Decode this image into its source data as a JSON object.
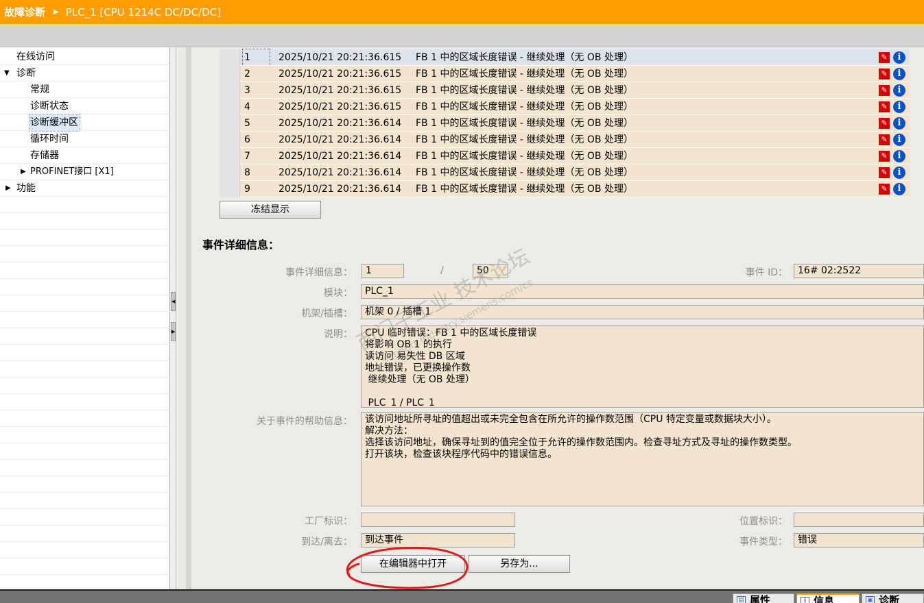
{
  "title": {
    "main": "故障诊断",
    "device": "PLC_1 [CPU 1214C DC/DC/DC]"
  },
  "sidebar": {
    "items": [
      {
        "label": "在线访问",
        "arrow": ""
      },
      {
        "label": "诊断",
        "arrow": "▼"
      },
      {
        "label": "常规",
        "arrow": ""
      },
      {
        "label": "诊断状态",
        "arrow": ""
      },
      {
        "label": "诊断缓冲区",
        "arrow": ""
      },
      {
        "label": "循环时间",
        "arrow": ""
      },
      {
        "label": "存储器",
        "arrow": ""
      },
      {
        "label": "PROFINET接口 [X1]",
        "arrow": "▶"
      },
      {
        "label": "功能",
        "arrow": "▶"
      }
    ]
  },
  "buffer": {
    "rows": [
      {
        "num": "1",
        "time": "2025/10/21 20:21:36.615",
        "msg": "FB 1 中的区域长度错误 - 继续处理（无 OB 处理）"
      },
      {
        "num": "2",
        "time": "2025/10/21 20:21:36.615",
        "msg": "FB 1 中的区域长度错误 - 继续处理（无 OB 处理）"
      },
      {
        "num": "3",
        "time": "2025/10/21 20:21:36.615",
        "msg": "FB 1 中的区域长度错误 - 继续处理（无 OB 处理）"
      },
      {
        "num": "4",
        "time": "2025/10/21 20:21:36.615",
        "msg": "FB 1 中的区域长度错误 - 继续处理（无 OB 处理）"
      },
      {
        "num": "5",
        "time": "2025/10/21 20:21:36.614",
        "msg": "FB 1 中的区域长度错误 - 继续处理（无 OB 处理）"
      },
      {
        "num": "6",
        "time": "2025/10/21 20:21:36.614",
        "msg": "FB 1 中的区域长度错误 - 继续处理（无 OB 处理）"
      },
      {
        "num": "7",
        "time": "2025/10/21 20:21:36.614",
        "msg": "FB 1 中的区域长度错误 - 继续处理（无 OB 处理）"
      },
      {
        "num": "8",
        "time": "2025/10/21 20:21:36.614",
        "msg": "FB 1 中的区域长度错误 - 继续处理（无 OB 处理）"
      },
      {
        "num": "9",
        "time": "2025/10/21 20:21:36.614",
        "msg": "FB 1 中的区域长度错误 - 继续处理（无 OB 处理）"
      }
    ],
    "icons": [
      "diagnosis-wrench-icon",
      "info-icon"
    ],
    "freeze_button": "冻结显示"
  },
  "details": {
    "section_title": "事件详细信息：",
    "labels": {
      "event_details": "事件详细信息：",
      "event_id": "事件 ID：",
      "module": "模块：",
      "rack_slot": "机架/插槽：",
      "description": "说明：",
      "help": "关于事件的帮助信息：",
      "plant_id": "工厂标识：",
      "location_id": "位置标识：",
      "incoming_outgoing": "到达/离去：",
      "event_type": "事件类型："
    },
    "values": {
      "event_index": "1",
      "separator": "/",
      "event_total": "50",
      "event_id": "16# 02:2522",
      "module": "PLC_1",
      "rack_slot": "机架 0 / 插槽 1",
      "description": "CPU 临时错误：FB 1 中的区域长度错误\n将影响 OB 1 的执行\n读访问 易失性 DB 区域\n地址错误，已更换操作数\n 继续处理（无 OB 处理）\n\n PLC_1 / PLC_1",
      "help": "该访问地址所寻址的值超出或未完全包含在所允许的操作数范围（CPU 特定变量或数据块大小）。\n解决方法：\n选择该访问地址，确保寻址到的值完全位于允许的操作数范围内。检查寻址方式及寻址的操作数类型。\n打开该块，检查该块程序代码中的错误信息。",
      "plant_id": "",
      "location_id": "",
      "incoming_outgoing": "到达事件",
      "event_type": "错误"
    },
    "buttons": {
      "open_in_editor": "在编辑器中打开",
      "save_as": "另存为..."
    }
  },
  "watermark": {
    "line1": "西门子工业 技术论坛",
    "line2": "support.industry.siemens.com/cs"
  },
  "bottom_tabs": [
    {
      "label": "属性",
      "icon": "properties-icon"
    },
    {
      "label": "信息",
      "icon": "info-tab-icon"
    },
    {
      "label": "诊断",
      "icon": "diagnostics-tab-icon"
    }
  ],
  "colors": {
    "title_bar": "#ff9c00",
    "field_bg": "#f2e4cf",
    "annotation_circle": "#e01b1b",
    "info_icon": "#0a53c7",
    "wrench_icon": "#d40000"
  }
}
